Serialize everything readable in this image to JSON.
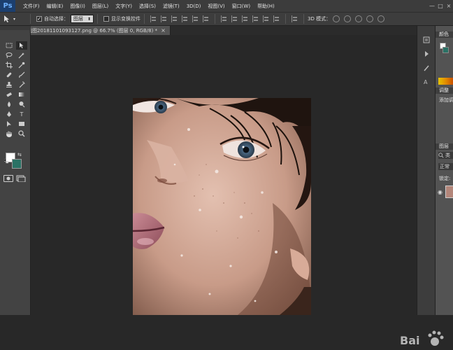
{
  "app": {
    "logo": "Ps",
    "menus": [
      "文件(F)",
      "编辑(E)",
      "图像(I)",
      "图层(L)",
      "文字(Y)",
      "选择(S)",
      "滤镜(T)",
      "3D(D)",
      "视图(V)",
      "窗口(W)",
      "帮助(H)"
    ],
    "window_controls": [
      "—",
      "□",
      "×"
    ]
  },
  "options_bar": {
    "auto_select_label": "自动选择：",
    "auto_select_checked": true,
    "auto_select_value": "图层",
    "show_transform_label": "显示变换控件",
    "mode_3d_label": "3D 模式："
  },
  "document": {
    "tab_title": "QQ截图20181101093127.png @ 66.7% (图层 0, RGB/8) *",
    "tab_close": "×"
  },
  "tools": {
    "text_tool_glyph": "T",
    "foreground_color": "#ffffff",
    "background_color": "#2a7265"
  },
  "panels": {
    "color_header": "颜色",
    "adjust_header": "调整",
    "adjust_add_label": "添加调",
    "layers_header": "图层",
    "layers_filter_label": "类",
    "blend_mode": "正常",
    "lock_label": "锁定:"
  },
  "watermark": {
    "text": "Bai"
  }
}
